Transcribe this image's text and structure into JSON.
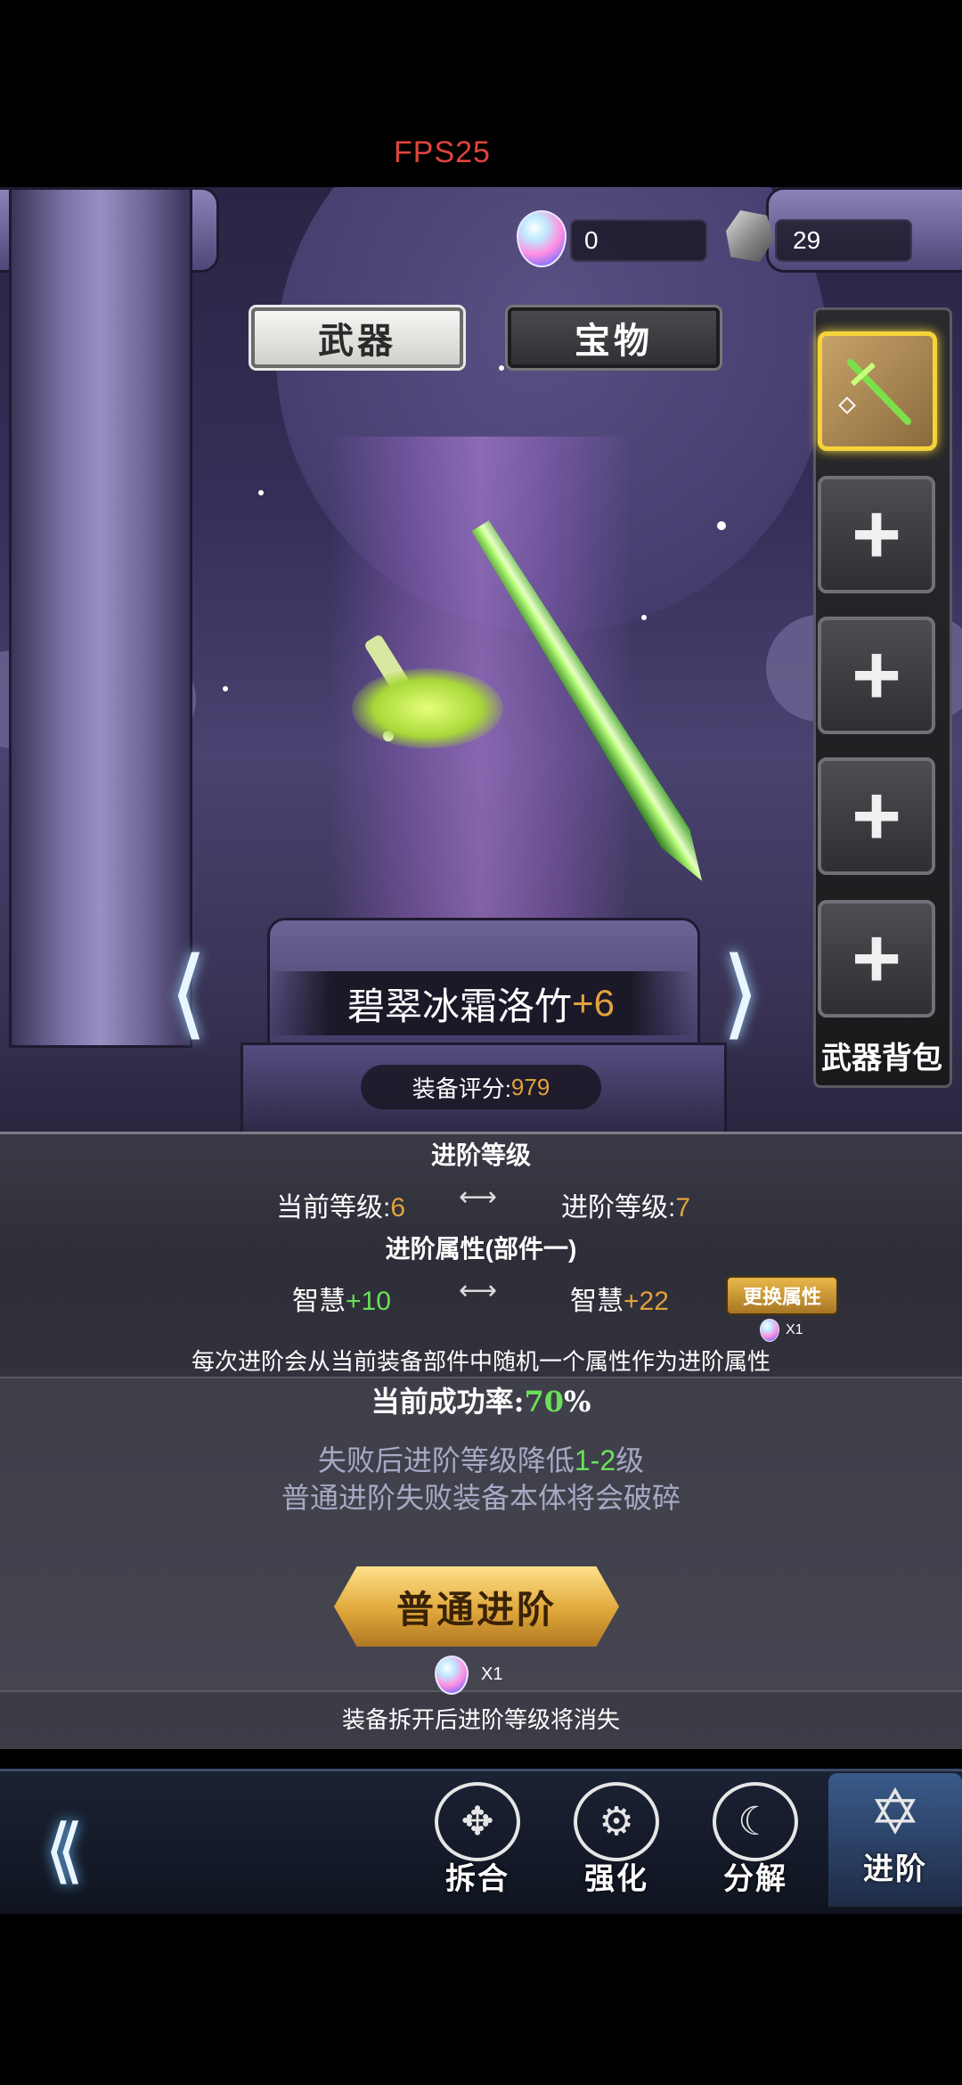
{
  "hud": {
    "fps": "FPS25"
  },
  "currency": [
    {
      "icon": "gem-icon",
      "value": "0"
    },
    {
      "icon": "ore-icon",
      "value": "29"
    }
  ],
  "tabs": [
    {
      "label": "武器",
      "active": true
    },
    {
      "label": "宝物",
      "active": false
    }
  ],
  "slots": {
    "bag_label": "武器背包",
    "empty_symbol": "+"
  },
  "equipment": {
    "name": "碧翠冰霜洛竹",
    "enhance": "+6",
    "score_label": "装备评分:",
    "score": "979"
  },
  "advance_level": {
    "title": "进阶等级",
    "current_label": "当前等级:",
    "current_value": "6",
    "next_label": "进阶等级:",
    "next_value": "7"
  },
  "advance_attr": {
    "title": "进阶属性(部件一)",
    "current_name": "智慧",
    "current_value": "+10",
    "next_name": "智慧",
    "next_value": "+22",
    "swap_label": "更换属性",
    "swap_cost": "X1",
    "description": "每次进阶会从当前装备部件中随机一个属性作为进阶属性"
  },
  "success": {
    "label": "当前成功率:",
    "value": "70",
    "unit": "%"
  },
  "notes": {
    "line1_prefix": "失败后进阶等级降低",
    "line1_range": "1-2",
    "line1_suffix": "级",
    "line2": "普通进阶失败装备本体将会破碎"
  },
  "action": {
    "button_label": "普通进阶",
    "cost": "X1",
    "warning": "装备拆开后进阶等级将消失"
  },
  "nav": [
    {
      "label": "拆合",
      "icon": "dismantle-icon",
      "glyph": "✥",
      "active": false
    },
    {
      "label": "强化",
      "icon": "enhance-icon",
      "glyph": "⚙",
      "active": false
    },
    {
      "label": "分解",
      "icon": "decompose-icon",
      "glyph": "☾",
      "active": false
    },
    {
      "label": "进阶",
      "icon": "advance-icon",
      "glyph": "✡",
      "active": true
    }
  ]
}
